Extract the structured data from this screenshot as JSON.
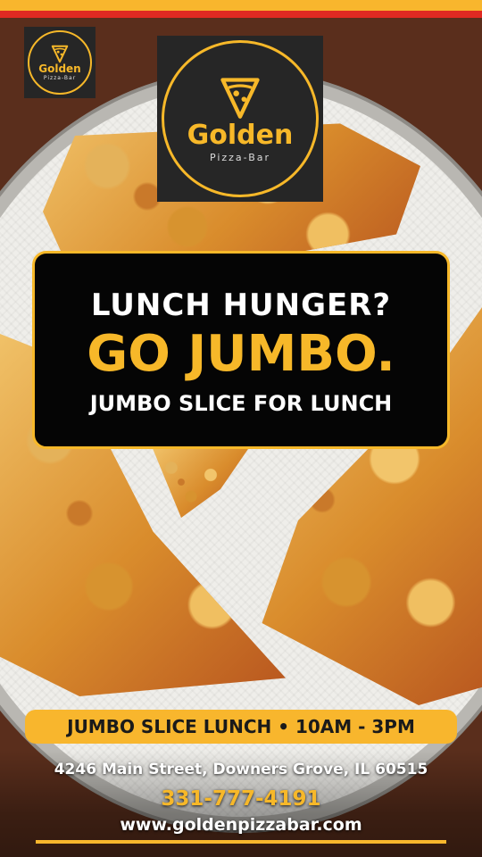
{
  "brand": {
    "name": "Golden",
    "tagline": "Pizza-Bar",
    "colors": {
      "gold": "#f7b829",
      "red": "#e02a22",
      "black": "#050505"
    },
    "icon": "pizza-slice-icon"
  },
  "promo": {
    "question": "LUNCH HUNGER?",
    "headline": "GO JUMBO.",
    "subhead": "JUMBO SLICE FOR LUNCH"
  },
  "hours": {
    "label": "JUMBO SLICE LUNCH • 10AM - 3PM"
  },
  "contact": {
    "address": "4246 Main Street, Downers Grove, IL 60515",
    "phone": "331-777-4191",
    "website": "www.goldenpizzabar.com"
  }
}
